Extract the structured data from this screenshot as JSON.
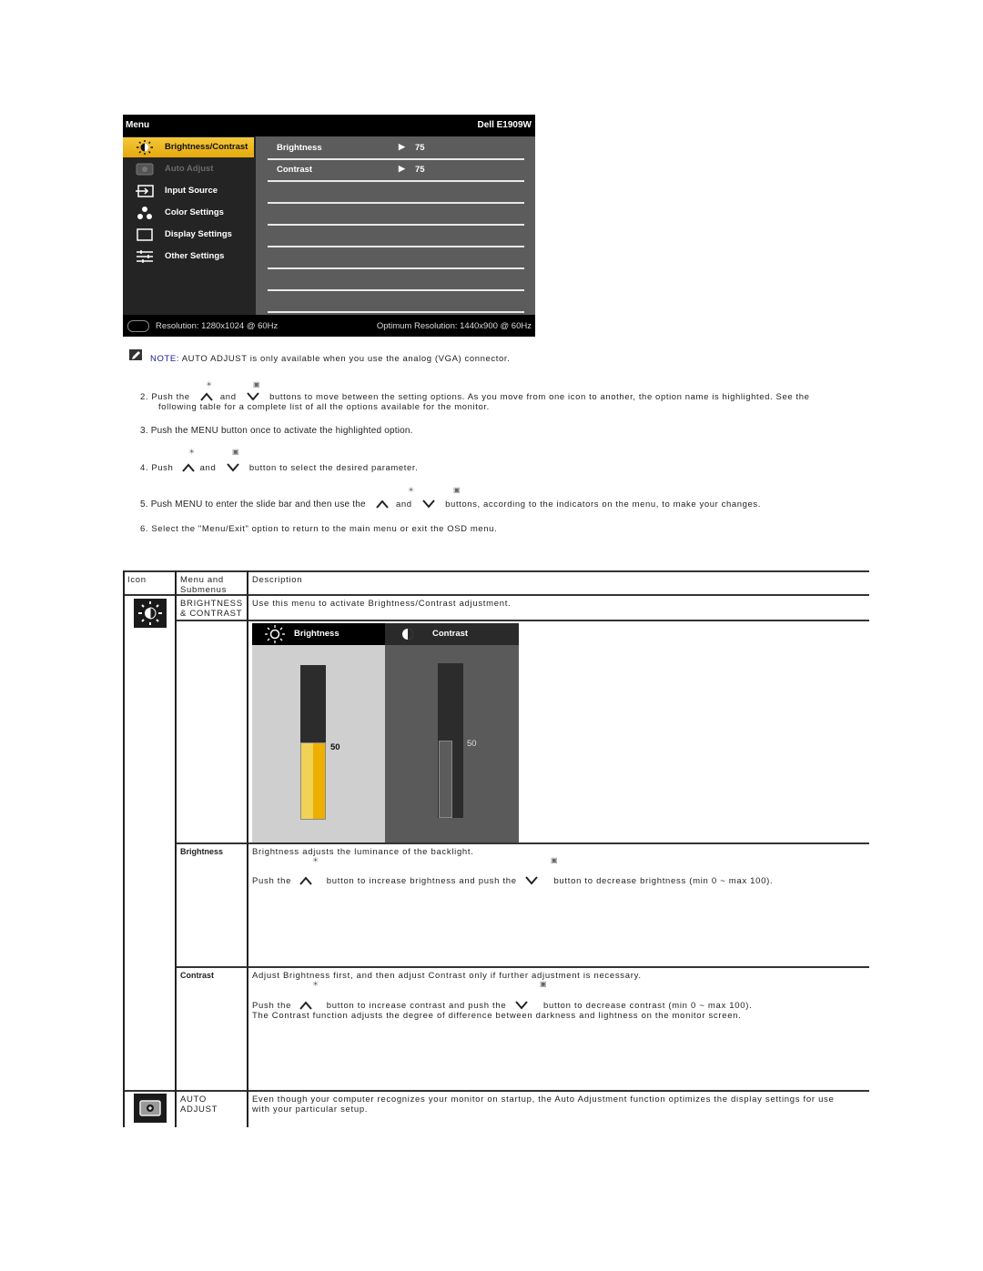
{
  "osd": {
    "title": "Menu",
    "model": "Dell E1909W",
    "menu_items": [
      {
        "label": "Brightness/Contrast",
        "icon": "brightness-contrast-icon",
        "state": "selected"
      },
      {
        "label": "Auto Adjust",
        "icon": "auto-adjust-icon",
        "state": "disabled"
      },
      {
        "label": "Input Source",
        "icon": "input-source-icon",
        "state": "normal"
      },
      {
        "label": "Color Settings",
        "icon": "color-settings-icon",
        "state": "normal"
      },
      {
        "label": "Display Settings",
        "icon": "display-settings-icon",
        "state": "normal"
      },
      {
        "label": "Other Settings",
        "icon": "other-settings-icon",
        "state": "normal"
      }
    ],
    "options": [
      {
        "name": "Brightness",
        "value": "75"
      },
      {
        "name": "Contrast",
        "value": "75"
      }
    ],
    "resolution": "Resolution: 1280x1024 @ 60Hz",
    "optimum_resolution": "Optimum Resolution: 1440x900 @ 60Hz",
    "colors": {
      "highlight": "#e9ad14",
      "sidebar": "#242424",
      "panel": "#5c5c5c"
    }
  },
  "note": {
    "label": "NOTE:",
    "text": " AUTO ADJUST is only available when you use the analog (VGA) connector.",
    "label_color": "#1a1a9a"
  },
  "steps": {
    "s2_a": "2. Push the",
    "s2_and": "and",
    "s2_b": "buttons to move between the setting options. As you move from one icon to another, the option name is highlighted. See the",
    "s2_c": "following table for a complete list of all the options available for the monitor.",
    "s3": "3. Push the MENU button once to activate the highlighted option.",
    "s4_a": "4. Push",
    "s4_and": "and",
    "s4_b": "button to select the desired parameter.",
    "s5_a": "5. Push MENU to enter the slide bar and then use the",
    "s5_and": "and",
    "s5_b": "buttons, according to the indicators on the menu, to make your changes.",
    "s6": "6. Select the \"Menu/Exit\" option to return to the main menu or exit the OSD menu."
  },
  "table": {
    "headers": {
      "icon": "Icon",
      "menu": "Menu and Submenus",
      "desc": "Description"
    },
    "bc": {
      "menu_l1": "BRIGHTNESS",
      "menu_l2": "& CONTRAST",
      "desc": "Use this menu to activate Brightness/Contrast adjustment."
    },
    "slider_panel": {
      "brightness_label": "Brightness",
      "contrast_label": "Contrast",
      "brightness_value": "50",
      "contrast_value": "50",
      "brightness_fraction": 0.5,
      "contrast_fraction": 0.5
    },
    "brightness": {
      "name": "Brightness",
      "line1": "Brightness adjusts the luminance of the backlight.",
      "push": "Push the",
      "mid": "button to increase brightness and push the",
      "end": "button to decrease brightness (min 0 ~ max 100)."
    },
    "contrast": {
      "name": "Contrast",
      "line1": "Adjust Brightness first, and then adjust Contrast only if further adjustment is necessary.",
      "push": "Push the",
      "mid": "button to increase contrast and push the",
      "end": "button to decrease contrast (min 0 ~ max 100).",
      "line3": "The Contrast function adjusts the degree of difference between darkness and lightness on the monitor screen."
    },
    "auto": {
      "menu_l1": "AUTO",
      "menu_l2": "ADJUST",
      "desc_l1": "Even though your computer recognizes your monitor on startup, the Auto Adjustment function optimizes the display settings for use",
      "desc_l2": "with your particular setup."
    }
  }
}
